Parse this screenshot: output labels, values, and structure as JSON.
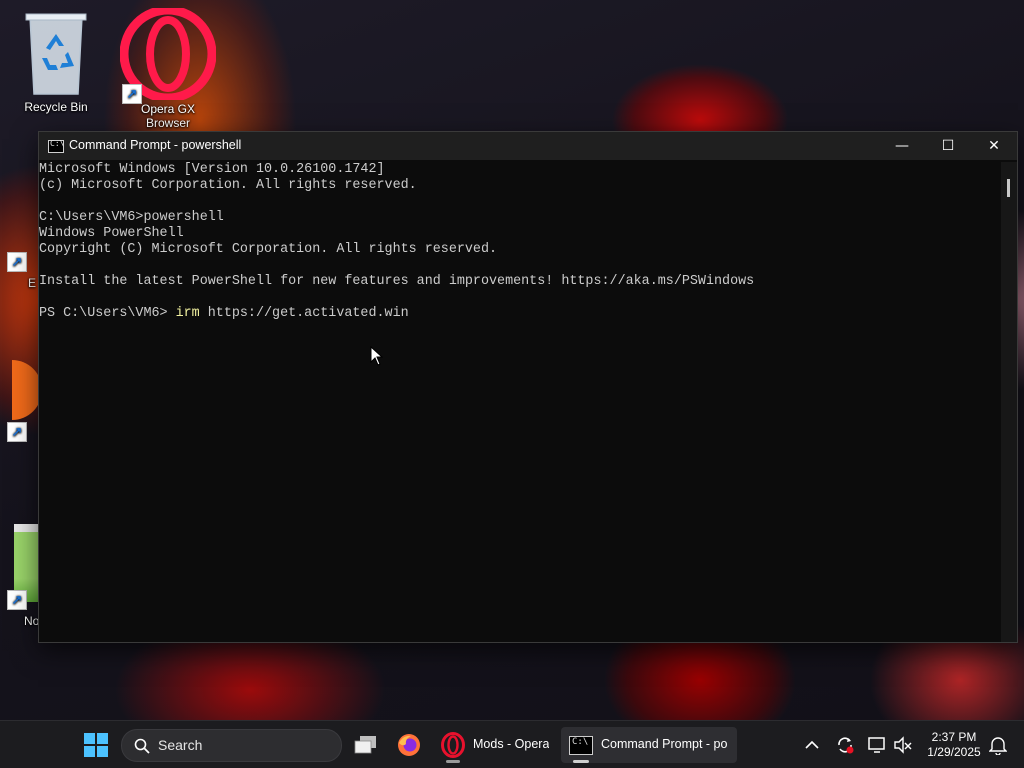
{
  "desktop": {
    "icons": [
      {
        "label": "Recycle Bin"
      },
      {
        "label": "Opera GX Browser"
      },
      {
        "label": "E"
      },
      {
        "label": "No"
      }
    ]
  },
  "window": {
    "title": "Command Prompt - powershell",
    "buttons": {
      "minimize": "—",
      "maximize": "☐",
      "close": "✕"
    },
    "console_lines": [
      "Microsoft Windows [Version 10.0.26100.1742]",
      "(c) Microsoft Corporation. All rights reserved.",
      "",
      "C:\\Users\\VM6>powershell",
      "Windows PowerShell",
      "Copyright (C) Microsoft Corporation. All rights reserved.",
      "",
      "Install the latest PowerShell for new features and improvements! https://aka.ms/PSWindows",
      "",
      "PS C:\\Users\\VM6> "
    ],
    "prompt_command": {
      "keyword": "irm",
      "argument": " https://get.activated.win"
    }
  },
  "taskbar": {
    "search_placeholder": "Search",
    "tasks": [
      {
        "label": "Mods - Opera"
      },
      {
        "label": "Command Prompt - po"
      }
    ],
    "clock": {
      "time": "2:37 PM",
      "date": "1/29/2025"
    }
  },
  "colors": {
    "console_bg": "#0c0c0c",
    "console_text": "#cccccc",
    "typed_command": "#f2f2a0",
    "taskbar_bg": "#1c1c1f",
    "opera_red": "#e8112d"
  }
}
